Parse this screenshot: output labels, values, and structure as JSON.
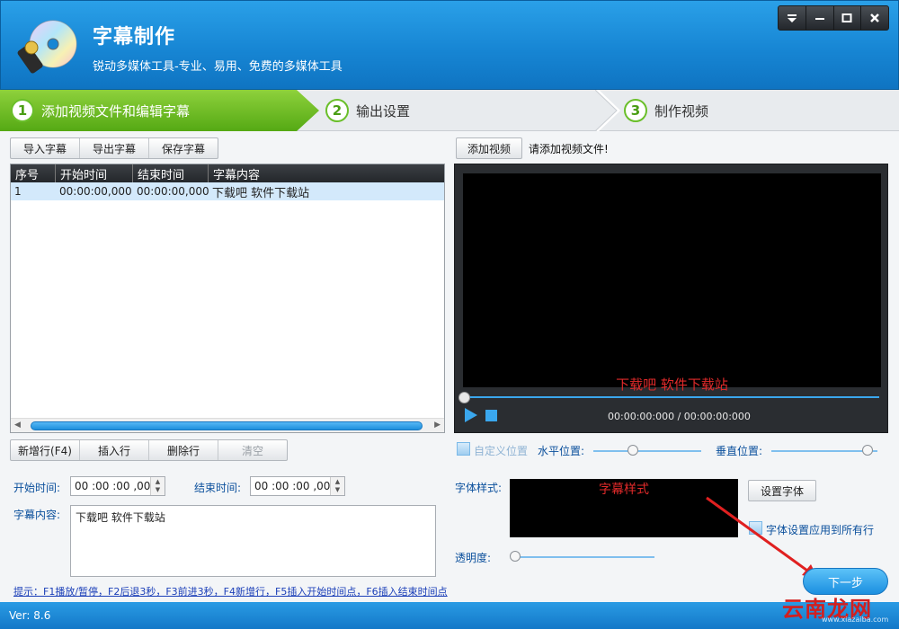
{
  "window": {
    "title": "字幕制作",
    "subtitle": "锐动多媒体工具-专业、易用、免费的多媒体工具",
    "controls": [
      "menu-icon",
      "minimize-icon",
      "maximize-icon",
      "close-icon"
    ]
  },
  "steps": [
    {
      "num": "1",
      "label": "添加视频文件和编辑字幕",
      "active": true
    },
    {
      "num": "2",
      "label": "输出设置",
      "active": false
    },
    {
      "num": "3",
      "label": "制作视频",
      "active": false
    }
  ],
  "toolbar": {
    "import": "导入字幕",
    "export": "导出字幕",
    "save": "保存字幕"
  },
  "table": {
    "headers": [
      "序号",
      "开始时间",
      "结束时间",
      "字幕内容"
    ],
    "rows": [
      {
        "index": "1",
        "start": "00:00:00,000",
        "end": "00:00:00,000",
        "content": "下载吧 软件下载站"
      }
    ]
  },
  "row_actions": {
    "add": "新增行(F4)",
    "insert": "插入行",
    "delete": "删除行",
    "clear": "清空"
  },
  "editor": {
    "start_label": "开始时间:",
    "start_value": "00 :00 :00 ,000",
    "end_label": "结束时间:",
    "end_value": "00 :00 :00 ,000",
    "content_label": "字幕内容:",
    "content_value": "下载吧 软件下载站"
  },
  "hint": "提示：F1播放/暂停，F2后退3秒，F3前进3秒，F4新增行，F5插入开始时间点，F6插入结束时间点",
  "video": {
    "add_button": "添加视频",
    "status": "请添加视频文件!",
    "overlay_subtitle": "下载吧 软件下载站",
    "time": "00:00:00:000 / 00:00:00:000"
  },
  "position": {
    "custom": "自定义位置",
    "horizontal": "水平位置:",
    "vertical": "垂直位置:"
  },
  "font": {
    "label": "字体样式:",
    "preview": "字幕样式",
    "set_button": "设置字体",
    "apply_all": "字体设置应用到所有行"
  },
  "opacity": {
    "label": "透明度:"
  },
  "next_button": "下一步",
  "status": {
    "version": "Ver: 8.6"
  },
  "watermark": {
    "text": "云南龙网",
    "sub": "www.xiazaiba.com"
  },
  "colors": {
    "accent": "#1786d4",
    "step_active": "#55a914",
    "subtitle_red": "#e02a2a"
  }
}
